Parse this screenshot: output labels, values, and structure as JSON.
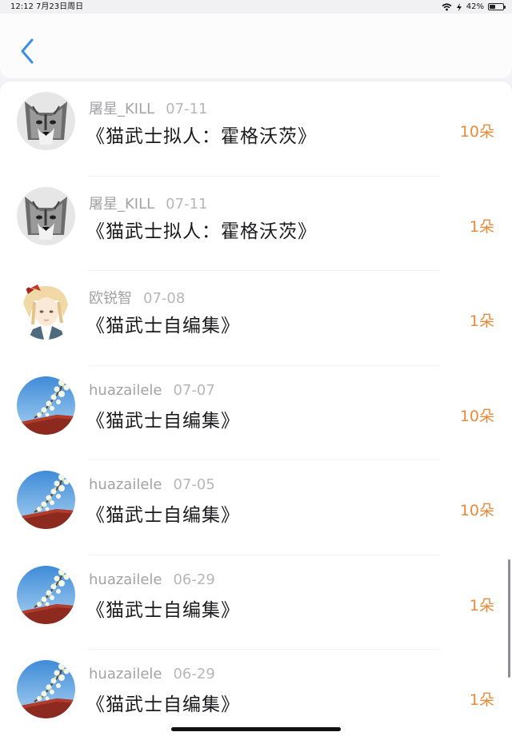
{
  "status_bar": {
    "time": "12:12",
    "date": "7月23日周日",
    "battery": "42%",
    "battery_level": 0.42,
    "icons": [
      "wifi-icon",
      "charging-icon",
      "battery-icon"
    ]
  },
  "nav": {
    "back_icon": "chevron-left-icon",
    "accent": "#3a8ee6"
  },
  "colors": {
    "flower_count": "#e98a3a",
    "username": "#a3a3a6",
    "title": "#1b1b1d"
  },
  "rows": [
    {
      "username": "屠星_KILL",
      "date": "07-11",
      "title": "《猫武士拟人：霍格沃茨》",
      "flowers": "10朵",
      "avatar": "wolf-avatar"
    },
    {
      "username": "屠星_KILL",
      "date": "07-11",
      "title": "《猫武士拟人：霍格沃茨》",
      "flowers": "1朵",
      "avatar": "wolf-avatar"
    },
    {
      "username": "欧锐智",
      "date": "07-08",
      "title": "《猫武士自编集》",
      "flowers": "1朵",
      "avatar": "anime-avatar"
    },
    {
      "username": "huazailele",
      "date": "07-07",
      "title": "《猫武士自编集》",
      "flowers": "10朵",
      "avatar": "blossom-avatar"
    },
    {
      "username": "huazailele",
      "date": "07-05",
      "title": "《猫武士自编集》",
      "flowers": "10朵",
      "avatar": "blossom-avatar"
    },
    {
      "username": "huazailele",
      "date": "06-29",
      "title": "《猫武士自编集》",
      "flowers": "1朵",
      "avatar": "blossom-avatar"
    },
    {
      "username": "huazailele",
      "date": "06-29",
      "title": "《猫武士自编集》",
      "flowers": "1朵",
      "avatar": "blossom-avatar"
    }
  ]
}
